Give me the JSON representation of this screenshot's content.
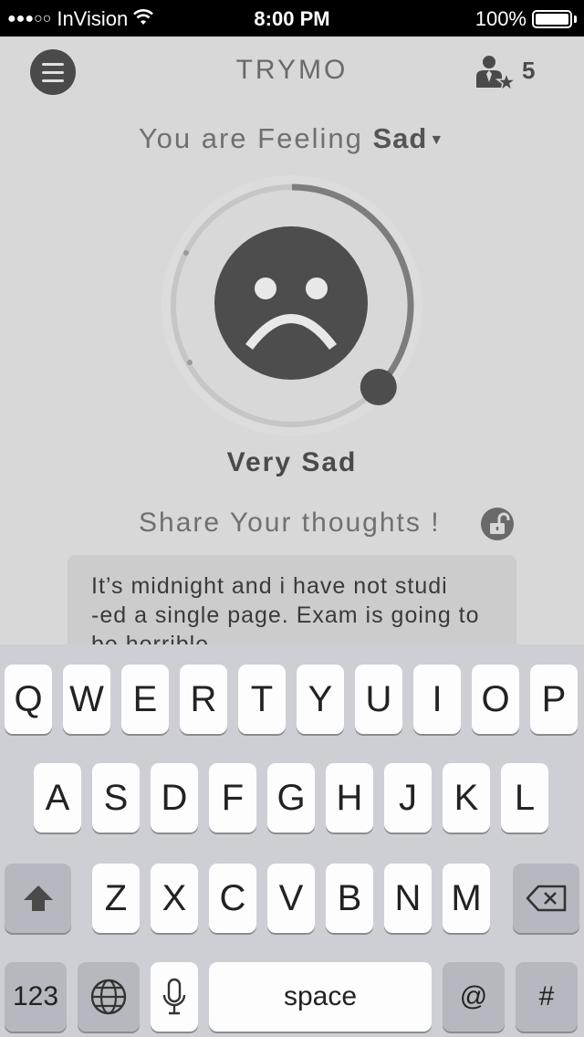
{
  "status_bar": {
    "signal_dots": "●●●○○",
    "carrier": "InVision",
    "time": "8:00 PM",
    "battery_percent": "100%"
  },
  "header": {
    "menu_icon": "hamburger-icon",
    "title": "TRYMO",
    "friends_icon": "person-star-icon",
    "friends_count": "5"
  },
  "feeling": {
    "prefix": "You are Feeling",
    "mood": "Sad",
    "dropdown_icon": "caret-down-icon"
  },
  "mood_dial": {
    "face_icon": "sad-face-icon",
    "level_fraction": 0.37,
    "label": "Very Sad"
  },
  "share": {
    "label": "Share Your thoughts !",
    "privacy_icon": "unlock-icon",
    "text": "It’s midnight and i have not studi\n-ed a single page. Exam is going to\n be horrible"
  },
  "keyboard": {
    "row1": [
      "Q",
      "W",
      "E",
      "R",
      "T",
      "Y",
      "U",
      "I",
      "O",
      "P"
    ],
    "row2": [
      "A",
      "S",
      "D",
      "F",
      "G",
      "H",
      "J",
      "K",
      "L"
    ],
    "row3": [
      "Z",
      "X",
      "C",
      "V",
      "B",
      "N",
      "M"
    ],
    "numbers_label": "123",
    "space_label": "space",
    "at_label": "@",
    "hash_label": "#",
    "shift_icon": "shift-arrow-icon",
    "delete_icon": "backspace-icon",
    "globe_icon": "globe-icon",
    "mic_icon": "microphone-icon"
  },
  "colors": {
    "background": "#d8d8d8",
    "accent_dark": "#4d4d4d",
    "ring_track": "#c4c4c4",
    "ring_progress": "#7d7d7d"
  }
}
